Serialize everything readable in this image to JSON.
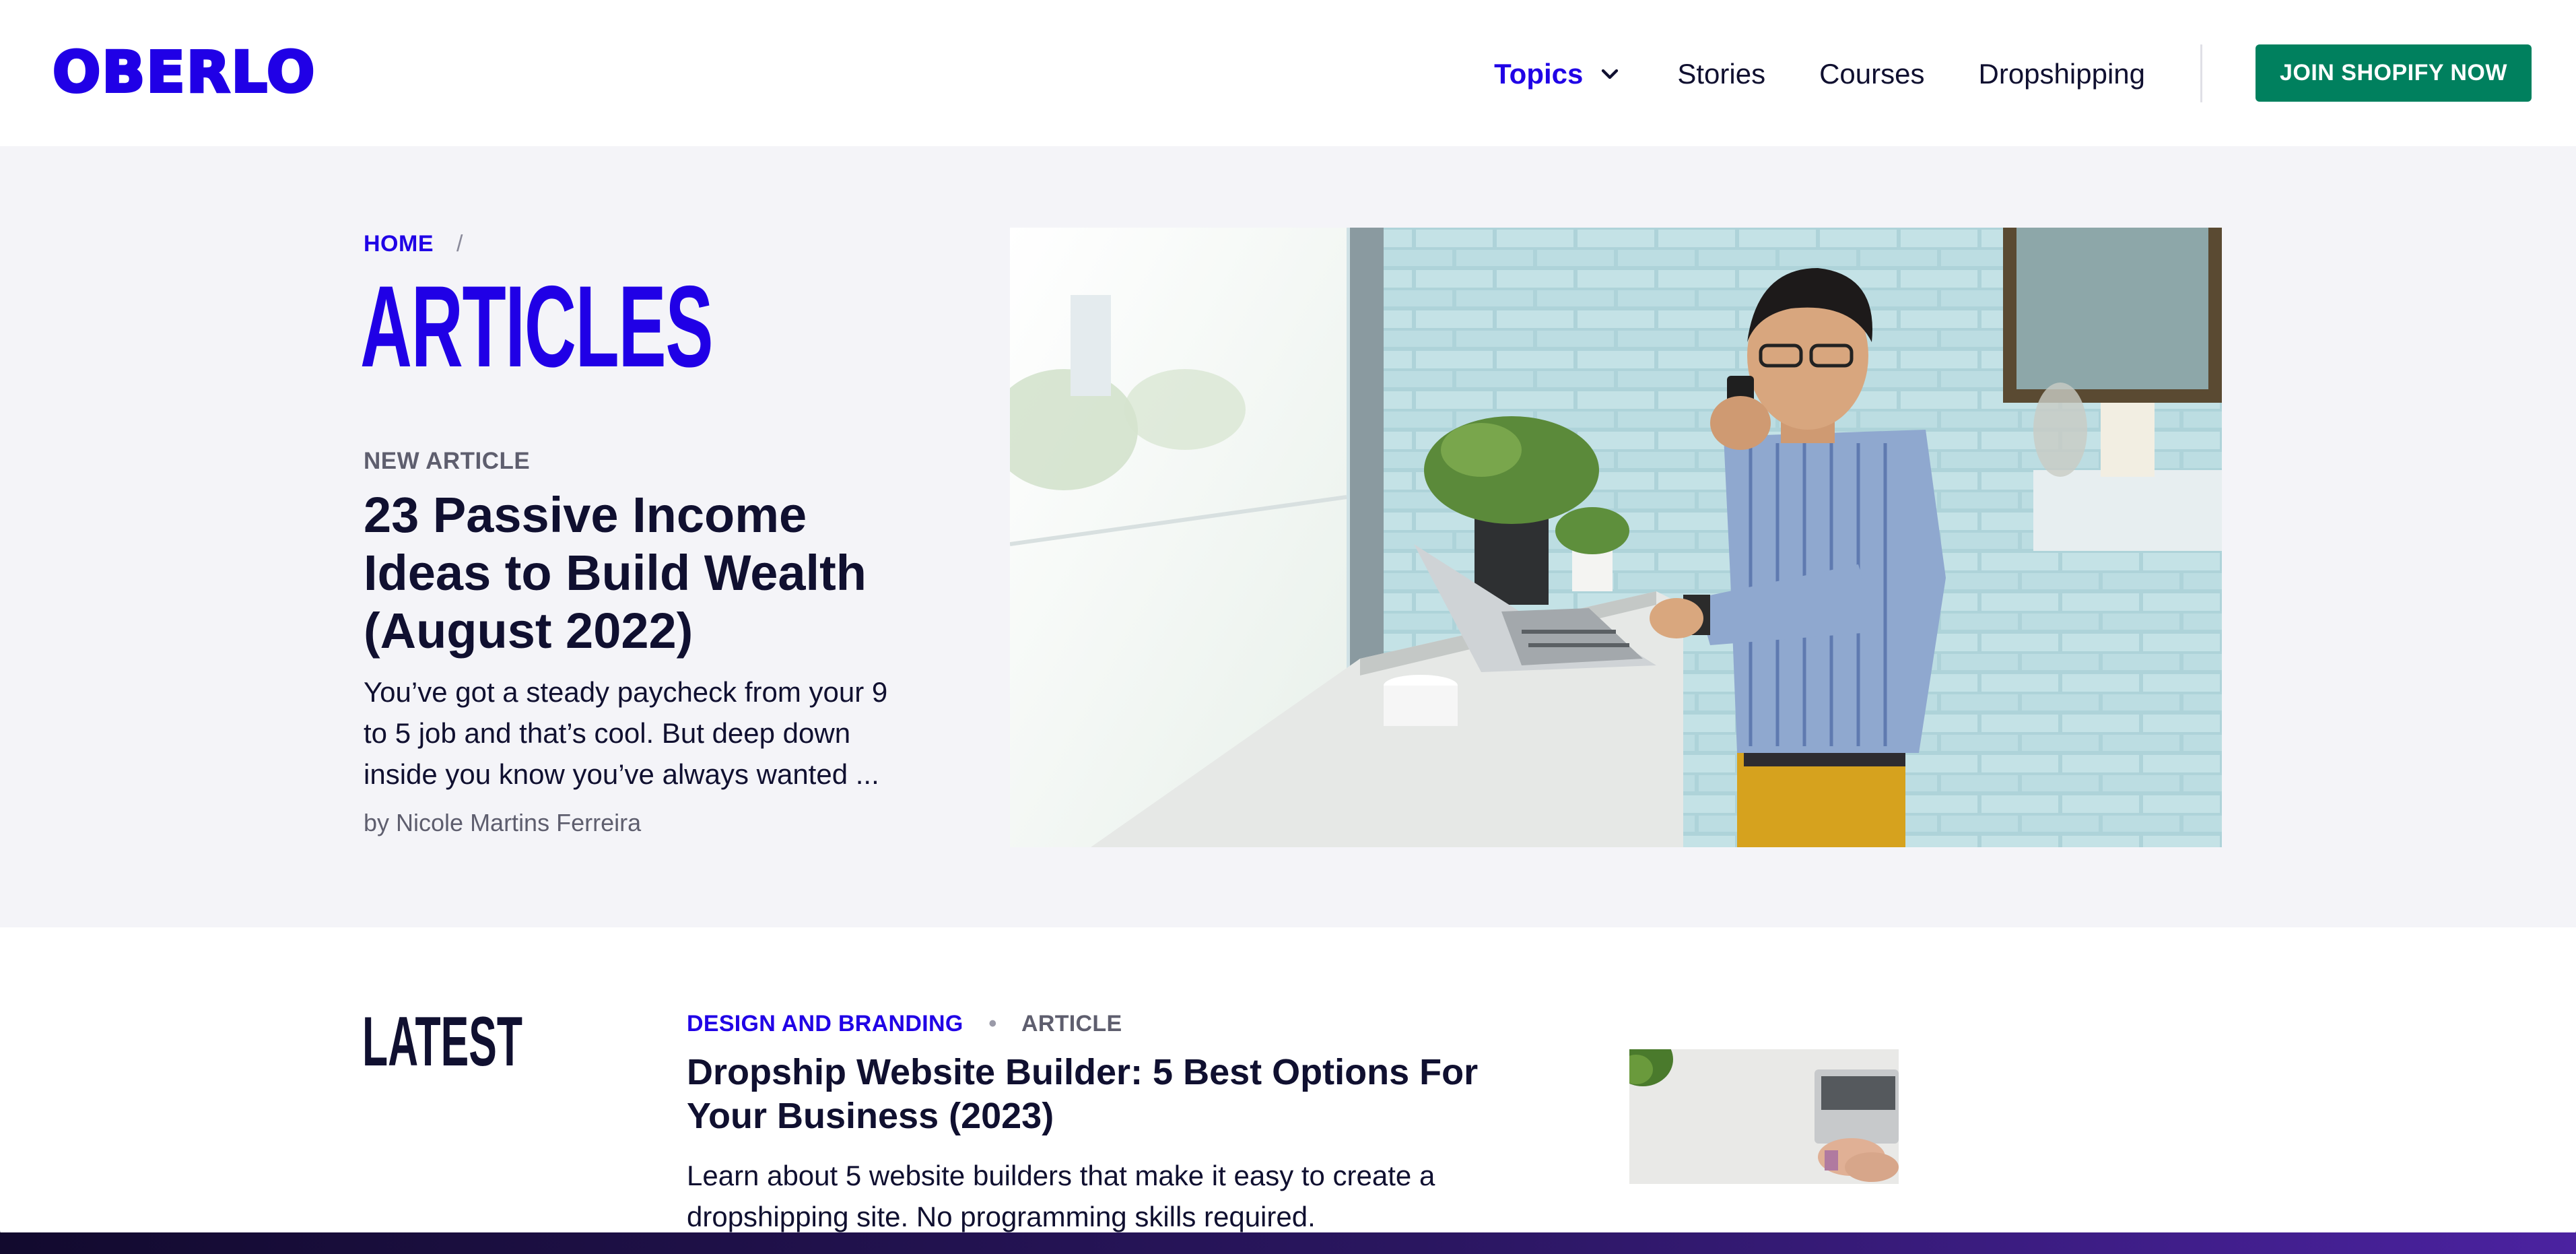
{
  "header": {
    "logo": "OBERLO",
    "nav": {
      "topics": "Topics",
      "stories": "Stories",
      "courses": "Courses",
      "dropshipping": "Dropshipping"
    },
    "cta": "JOIN SHOPIFY NOW"
  },
  "hero": {
    "breadcrumb_home": "HOME",
    "breadcrumb_sep": "/",
    "title": "ARTICLES",
    "kicker": "NEW ARTICLE",
    "feature_title": "23 Passive Income Ideas to Build Wealth (August 2022)",
    "feature_excerpt": "You’ve got a steady paycheck from your 9 to 5 job and that’s cool.  But deep down inside you know you’ve always wanted ...",
    "feature_author": "by Nicole Martins Ferreira"
  },
  "latest": {
    "heading": "LATEST",
    "category": "DESIGN AND BRANDING",
    "dot": "•",
    "type": "ARTICLE",
    "title": "Dropship Website Builder: 5 Best Options For Your Business (2023)",
    "excerpt": "Learn about 5 website builders that make it easy to create a dropshipping site. No programming skills required."
  },
  "colors": {
    "brand_blue": "#2000e6",
    "cta_green": "#00805e",
    "hero_bg": "#f4f4f8",
    "text_dark": "#101030"
  },
  "icons": {
    "topics_dropdown": "chevron-down-icon"
  }
}
